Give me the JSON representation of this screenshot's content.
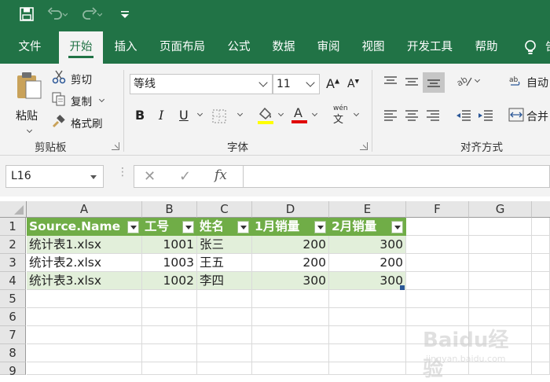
{
  "quick_access": {
    "save_icon": "save-icon",
    "undo_icon": "undo-icon",
    "redo_icon": "redo-icon",
    "customize_icon": "customize-qat-icon"
  },
  "tabs": [
    {
      "label": "文件"
    },
    {
      "label": "开始"
    },
    {
      "label": "插入"
    },
    {
      "label": "页面布局"
    },
    {
      "label": "公式"
    },
    {
      "label": "数据"
    },
    {
      "label": "审阅"
    },
    {
      "label": "视图"
    },
    {
      "label": "开发工具"
    },
    {
      "label": "帮助"
    }
  ],
  "active_tab": "开始",
  "clipboard": {
    "paste": "粘贴",
    "cut": "剪切",
    "copy": "复制",
    "format_painter": "格式刷",
    "group": "剪贴板"
  },
  "font": {
    "name": "等线",
    "size": "11",
    "bold": "B",
    "italic": "I",
    "underline": "U",
    "grow": "A",
    "shrink": "A",
    "group": "字体",
    "phonetic": "wén",
    "fill_color": "#ffff00",
    "font_color": "#e00000"
  },
  "alignment": {
    "wrap": "自动",
    "merge": "合并",
    "group": "对齐方式"
  },
  "formula_bar": {
    "name_box": "L16",
    "cancel": "✕",
    "enter": "✓",
    "fx": "fx",
    "value": ""
  },
  "columns": [
    "A",
    "B",
    "C",
    "D",
    "E",
    "F",
    "G"
  ],
  "rows": [
    "1",
    "2",
    "3",
    "4",
    "5",
    "6",
    "7",
    "8",
    "9"
  ],
  "table": {
    "headers": [
      "Source.Name",
      "工号",
      "姓名",
      "1月销量",
      "2月销量"
    ],
    "rows": [
      [
        "统计表1.xlsx",
        "1001",
        "张三",
        "200",
        "300"
      ],
      [
        "统计表2.xlsx",
        "1003",
        "王五",
        "200",
        "200"
      ],
      [
        "统计表3.xlsx",
        "1002",
        "李四",
        "300",
        "300"
      ]
    ],
    "header_color": "#70ad47",
    "band_color": "#e2efda"
  },
  "watermark": {
    "brand": "Baidu经验",
    "url": "jingyan.baidu.com"
  }
}
